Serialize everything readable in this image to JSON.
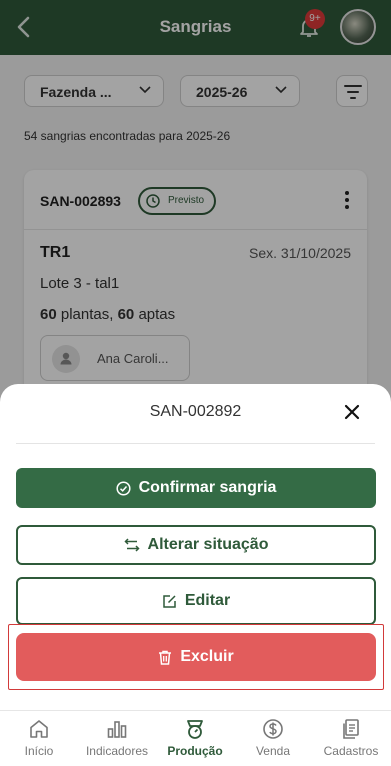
{
  "header": {
    "title": "Sangrias",
    "notification_badge": "9+"
  },
  "filters": {
    "farm": "Fazenda ...",
    "year": "2025-26"
  },
  "results_text": "54 sangrias encontradas para 2025-26",
  "card": {
    "code": "SAN-002893",
    "status": "Previsto",
    "location": "TR1",
    "date": "Sex. 31/10/2025",
    "lot": "Lote 3 - tal1",
    "plants_count": "60",
    "plants_label": "plantas,",
    "apt_count": "60",
    "apt_label": "aptas",
    "person": "Ana Caroli..."
  },
  "sheet": {
    "title": "SAN-002892",
    "confirm_label": "Confirmar sangria",
    "alter_label": "Alterar situação",
    "edit_label": "Editar",
    "delete_label": "Excluir"
  },
  "nav": {
    "items": [
      {
        "label": "Início",
        "icon": "home-icon"
      },
      {
        "label": "Indicadores",
        "icon": "bar-chart-icon"
      },
      {
        "label": "Produção",
        "icon": "scale-icon"
      },
      {
        "label": "Venda",
        "icon": "dollar-icon"
      },
      {
        "label": "Cadastros",
        "icon": "documents-icon"
      }
    ],
    "active_index": 2
  },
  "colors": {
    "primary": "#2f5a3a",
    "danger": "#e25c5c",
    "highlight_border": "#d23a3a"
  }
}
